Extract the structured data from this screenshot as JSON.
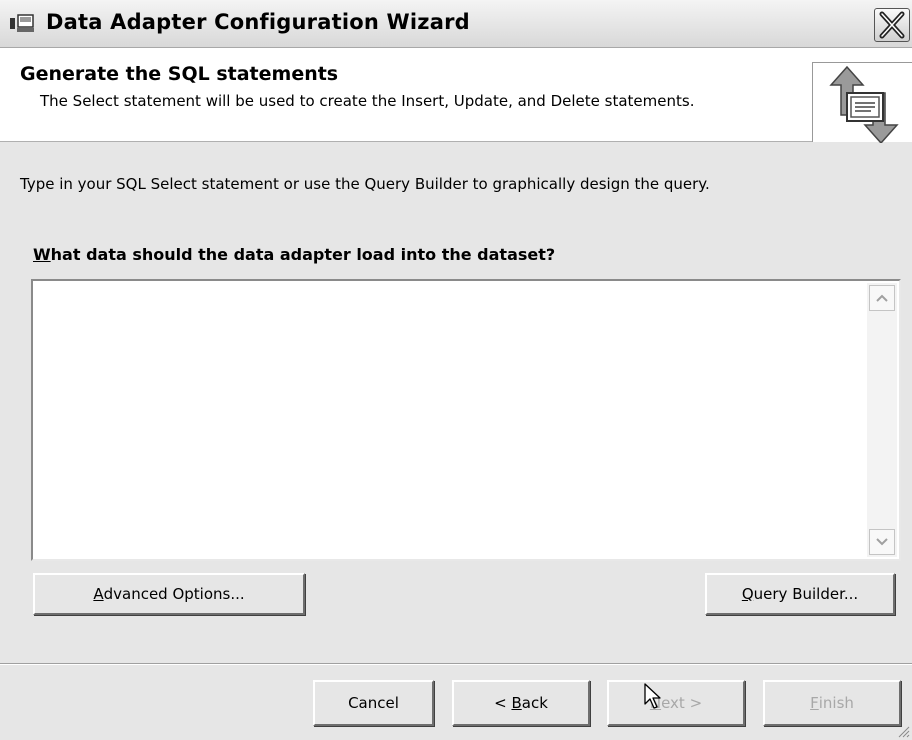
{
  "window": {
    "title": "Data Adapter Configuration Wizard"
  },
  "header": {
    "title": "Generate the SQL statements",
    "description": "The Select statement will be used to create the Insert, Update, and Delete statements."
  },
  "body": {
    "instructions": "Type in your SQL Select statement or use the Query Builder to graphically design the query.",
    "question_accel": "W",
    "question_rest": "hat data should the data adapter load into the dataset?",
    "sql_value": ""
  },
  "buttons": {
    "advanced_accel": "A",
    "advanced_rest": "dvanced Options...",
    "query_accel": "Q",
    "query_rest": "uery Builder...",
    "cancel": "Cancel",
    "back_pre": "< ",
    "back_accel": "B",
    "back_rest": "ack",
    "next_accel": "N",
    "next_rest": "ext >",
    "finish_accel": "F",
    "finish_rest": "inish"
  },
  "icons": {
    "app": "data-adapter-icon",
    "close": "close-icon",
    "wizard": "wizard-arrows-icon"
  },
  "colors": {
    "window_bg": "#e6e6e6",
    "header_bg": "#ffffff",
    "disabled_text": "#a8a8a8"
  }
}
